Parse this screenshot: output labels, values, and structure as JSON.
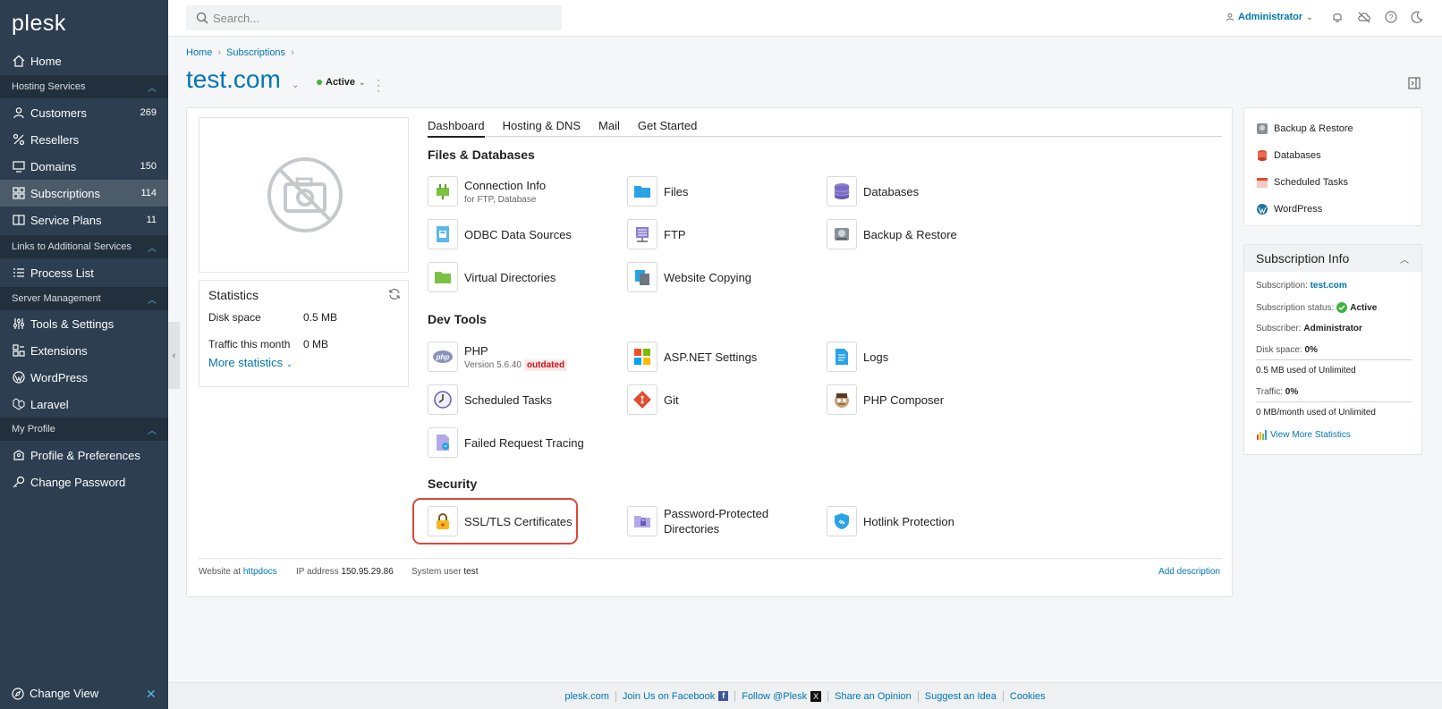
{
  "app": {
    "logo": "plesk"
  },
  "sidebar": {
    "items": [
      {
        "label": "Home",
        "icon": "home-icon"
      },
      {
        "label": "Customers",
        "count": "269",
        "icon": "user-icon"
      },
      {
        "label": "Resellers",
        "icon": "percent-icon"
      },
      {
        "label": "Domains",
        "count": "150",
        "icon": "monitor-icon"
      },
      {
        "label": "Subscriptions",
        "count": "114",
        "icon": "grid-icon",
        "active": true
      },
      {
        "label": "Service Plans",
        "count": "11",
        "icon": "book-icon"
      },
      {
        "label": "Process List",
        "icon": "list-icon"
      },
      {
        "label": "Tools & Settings",
        "icon": "sliders-icon"
      },
      {
        "label": "Extensions",
        "icon": "puzzle-icon"
      },
      {
        "label": "WordPress",
        "icon": "wordpress-icon"
      },
      {
        "label": "Laravel",
        "icon": "laravel-icon"
      },
      {
        "label": "Profile & Preferences",
        "icon": "profile-icon"
      },
      {
        "label": "Change Password",
        "icon": "key-icon"
      }
    ],
    "sections": [
      "Hosting Services",
      "Links to Additional Services",
      "Server Management",
      "My Profile"
    ],
    "change_view": "Change View"
  },
  "topbar": {
    "search_placeholder": "Search...",
    "user": "Administrator"
  },
  "breadcrumb": [
    "Home",
    "Subscriptions"
  ],
  "page": {
    "title": "test.com",
    "status": "Active"
  },
  "tabs": [
    "Dashboard",
    "Hosting & DNS",
    "Mail",
    "Get Started"
  ],
  "statistics": {
    "title": "Statistics",
    "disk_label": "Disk space",
    "disk_value": "0.5 MB",
    "traffic_label": "Traffic this month",
    "traffic_value": "0 MB",
    "more": "More statistics"
  },
  "sections": {
    "files": "Files & Databases",
    "dev": "Dev Tools",
    "security": "Security"
  },
  "tools": {
    "connection_info": "Connection Info",
    "connection_sub": "for FTP, Database",
    "files": "Files",
    "databases": "Databases",
    "odbc": "ODBC Data Sources",
    "ftp": "FTP",
    "backup": "Backup & Restore",
    "virtual_dirs": "Virtual Directories",
    "website_copying": "Website Copying",
    "php": "PHP",
    "php_version": "Version 5.6.40",
    "php_badge": "outdated",
    "aspnet": "ASP.NET Settings",
    "logs": "Logs",
    "scheduled": "Scheduled Tasks",
    "git": "Git",
    "composer": "PHP Composer",
    "failed_tracing": "Failed Request Tracing",
    "ssl": "SSL/TLS Certificates",
    "pwd_dirs_1": "Password-Protected",
    "pwd_dirs_2": "Directories",
    "hotlink": "Hotlink Protection"
  },
  "card_footer": {
    "website_label": "Website at",
    "website_value": "httpdocs",
    "ip_label": "IP address",
    "ip_value": "150.95.29.86",
    "sysuser_label": "System user",
    "sysuser_value": "test",
    "add_description": "Add description"
  },
  "right_panel": {
    "links": [
      "Backup & Restore",
      "Databases",
      "Scheduled Tasks",
      "WordPress"
    ],
    "info_title": "Subscription Info",
    "subscription_label": "Subscription:",
    "subscription_value": "test.com",
    "status_label": "Subscription status:",
    "status_value": "Active",
    "subscriber_label": "Subscriber:",
    "subscriber_value": "Administrator",
    "disk_label": "Disk space:",
    "disk_value": "0%",
    "disk_detail": "0.5 MB used of Unlimited",
    "traffic_label": "Traffic:",
    "traffic_value": "0%",
    "traffic_detail": "0 MB/month used of Unlimited",
    "view_more": "View More Statistics"
  },
  "footer": {
    "links": [
      "plesk.com",
      "Join Us on Facebook",
      "Follow @Plesk",
      "Share an Opinion",
      "Suggest an Idea",
      "Cookies"
    ]
  }
}
